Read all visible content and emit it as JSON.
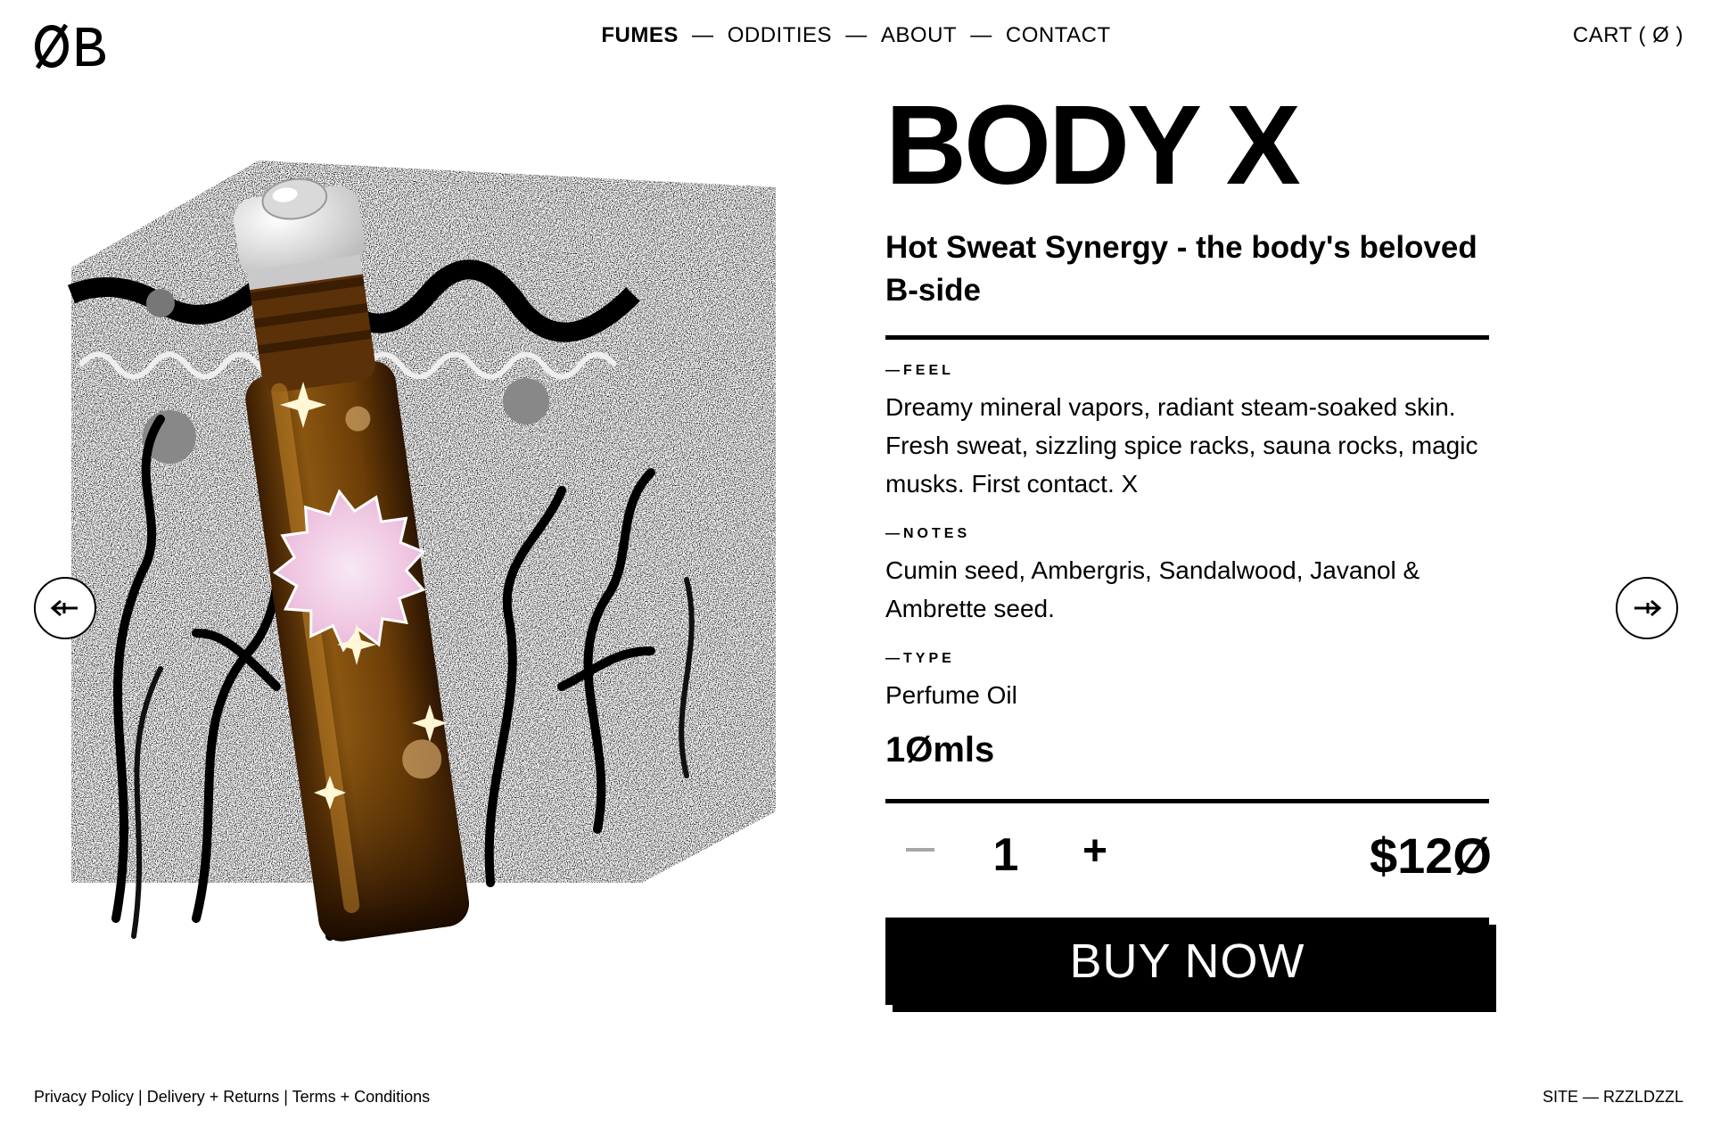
{
  "header": {
    "logo_text": "ØB",
    "nav": {
      "items": [
        "FUMES",
        "ODDITIES",
        "ABOUT",
        "CONTACT"
      ],
      "separator": "—",
      "active": "FUMES"
    },
    "cart_label": "CART ( Ø )"
  },
  "carousel": {
    "prev_icon": "arrow-left-icon",
    "next_icon": "arrow-right-icon"
  },
  "product": {
    "title": "BODY X",
    "subtitle": "Hot Sweat Synergy - the body's beloved B-side",
    "feel_label": "—FEEL",
    "feel_text": "Dreamy mineral vapors, radiant steam-soaked skin. Fresh sweat, sizzling spice racks, sauna rocks, magic musks. First contact. X",
    "notes_label": "—NOTES",
    "notes_text": "Cumin seed, Ambergris, Sandalwood, Javanol & Ambrette seed.",
    "type_label": "—TYPE",
    "type_text": "Perfume Oil",
    "size": "1Ømls",
    "quantity": "1",
    "minus_label": "−",
    "plus_label": "+",
    "price": "$12Ø",
    "buy_label": "BUY NOW"
  },
  "footer": {
    "links": "Privacy Policy | Delivery + Returns | Terms + Conditions",
    "credit": "SITE — RZZLDZZL"
  },
  "colors": {
    "text": "#000000",
    "background": "#ffffff",
    "button_bg": "#000000",
    "button_text": "#ffffff",
    "disabled": "#a7a7a7",
    "amber_glass": "#7a4a0c"
  }
}
